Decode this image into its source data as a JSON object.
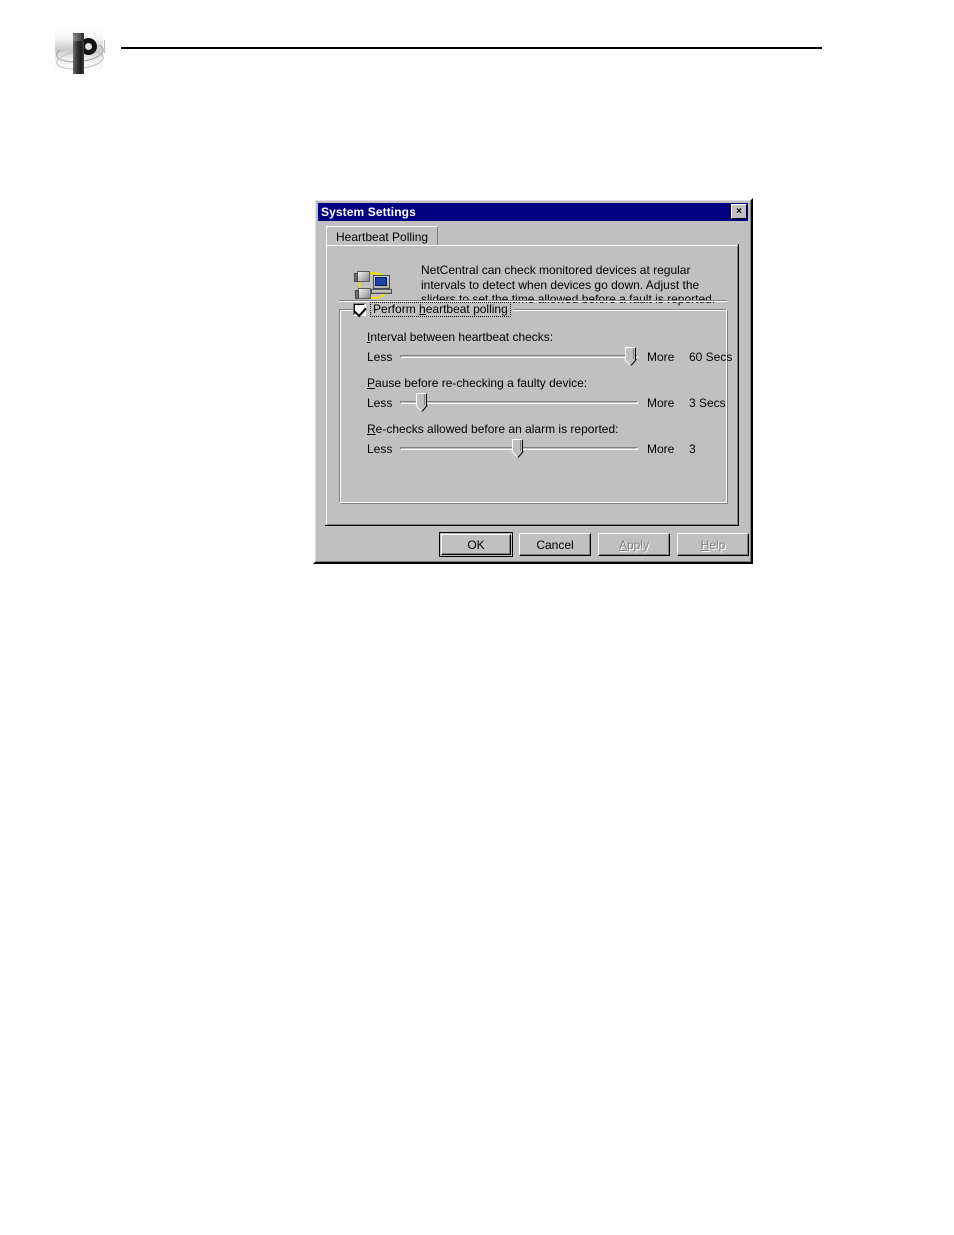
{
  "page": {
    "logo_name": "grass-valley-logo"
  },
  "dialog": {
    "title": "System Settings",
    "close_glyph": "×",
    "tabs": [
      {
        "label": "Heartbeat Polling",
        "selected": true
      }
    ],
    "description": "NetCentral can check monitored devices at regular intervals to detect when devices go down. Adjust the sliders to set the time allowed before a fault is reported.",
    "description_icon": "network-devices-icon",
    "group": {
      "checkbox_label_pre": "P",
      "checkbox_label_accel": "h",
      "checkbox_label_post": "eartbeat polling",
      "checkbox_label_full": "Perform heartbeat polling",
      "checkbox_checked": true,
      "sliders": [
        {
          "caption_accel": "I",
          "caption_rest": "nterval between heartbeat checks:",
          "caption_full": "Interval between heartbeat checks:",
          "min_label": "Less",
          "max_label": "More",
          "value_label": "60 Secs",
          "value": 60,
          "percent": 100
        },
        {
          "caption_accel": "P",
          "caption_rest": "ause before re-checking a faulty device:",
          "caption_full": "Pause before re-checking a faulty device:",
          "min_label": "Less",
          "max_label": "More",
          "value_label": "3 Secs",
          "value": 3,
          "percent": 7
        },
        {
          "caption_accel": "R",
          "caption_rest": "e-checks allowed before an alarm is reported:",
          "caption_full": "Re-checks allowed before an alarm is reported:",
          "min_label": "Less",
          "max_label": "More",
          "value_label": "3",
          "value": 3,
          "percent": 49
        }
      ]
    },
    "buttons": [
      {
        "label": "OK",
        "state": "default"
      },
      {
        "label": "Cancel",
        "state": "normal"
      },
      {
        "label": "Apply",
        "accel": "A",
        "state": "disabled"
      },
      {
        "label": "Help",
        "accel": "H",
        "state": "disabled"
      }
    ]
  },
  "colors": {
    "titlebar": "#000080",
    "face": "#c0c0c0",
    "disabled_text": "#808080"
  }
}
